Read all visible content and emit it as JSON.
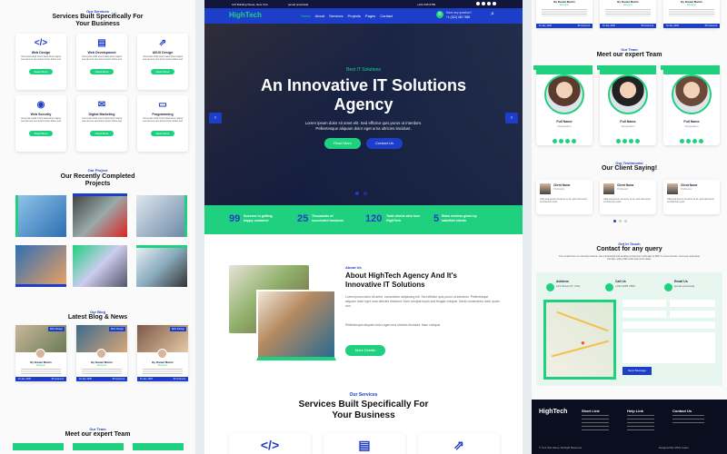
{
  "brand": {
    "name": "HighTech"
  },
  "topbar": {
    "address": "123 Building Street, New York",
    "email": "[email protected]",
    "phone": "+012 345 6789",
    "help": "Have any question?",
    "help_phone": "+1 (202) 445 7865"
  },
  "nav": {
    "items": [
      "Home",
      "About",
      "Services",
      "Projects",
      "Pages",
      "Contact"
    ],
    "active": "Home"
  },
  "hero": {
    "tag": "Best IT Solutions",
    "title_line1": "An Innovative IT Solutions",
    "title_line2": "Agency",
    "text_line1": "Lorem ipsum dolor sit amet elit. Sed efficitur quis purus ut interdum.",
    "text_line2": "Pellentesque aliquam dolor eget urna ultricies tincidunt.",
    "btn_primary": "Read More",
    "btn_secondary": "Contact Us"
  },
  "stats": [
    {
      "value": "99",
      "label": "Success in getting happy customer"
    },
    {
      "value": "25",
      "label": "Thousands of successful business"
    },
    {
      "value": "120",
      "label": "Total clients who love HighTech"
    },
    {
      "value": "5",
      "label": "Stars reviews given by satisfied clients"
    }
  ],
  "about": {
    "tag": "About Us",
    "title_line1": "About HighTech Agency And It's",
    "title_line2": "Innovative IT Solutions",
    "p1": "Lorem ipsum dolor sit amet, consectetur adipiscing elit. Sed efficitur quis purus ut interdum. Pellentesque aliquam dolor eget urna ultricies tincidunt. Nam volutpat turpis sed feugiat volutpat. Morbi consectetur dolor quam non.",
    "p2": "Pellentesque aliquam dolor eget urna ultricies tincidunt. Nam volutpat.",
    "button": "More Details"
  },
  "services": {
    "tag": "Our Services",
    "title_line1": "Services Built Specifically For",
    "title_line2": "Your Business",
    "items": [
      {
        "label": "Web Design",
        "icon": "code-icon"
      },
      {
        "label": "Web Development",
        "icon": "file-code-icon"
      },
      {
        "label": "UI/UX Design",
        "icon": "external-link-icon"
      },
      {
        "label": "Web Security",
        "icon": "user-secret-icon"
      },
      {
        "label": "Digital Marketing",
        "icon": "envelope-open-icon"
      },
      {
        "label": "Programming",
        "icon": "laptop-icon"
      }
    ],
    "item_text": "Amet justo dolor lorem kasd amet magna sea stet eos vero lorem ipsum dolore sed",
    "read_more": "Read More"
  },
  "projects": {
    "tag": "Our Project",
    "title_line1": "Our Recently Completed",
    "title_line2": "Projects"
  },
  "blog": {
    "tag": "Our Blog",
    "title": "Latest Blog & News",
    "category": "Web Design",
    "author": "By Daniel Martin",
    "role": "Designer",
    "date": "01 Jan, 2045",
    "comments": "15 Comment"
  },
  "team": {
    "tag": "Our Team",
    "title": "Meet our expert Team",
    "members": [
      {
        "name": "Full Name",
        "role": "Designation"
      },
      {
        "name": "Full Name",
        "role": "Designation"
      },
      {
        "name": "Full Name",
        "role": "Designation"
      }
    ]
  },
  "testimonial": {
    "tag": "Our Testimonial",
    "title": "Our Client Saying!",
    "client": "Client Name",
    "profession": "Profession",
    "text": "Clita erat ipsum et lorem et sit, sed stet lorem sit clita duo justo."
  },
  "contact": {
    "tag": "Get In Touch",
    "title": "Contact for any query",
    "note": "The contact form is currently inactive. Get a functional and working contact form with Ajax & PHP in a few minutes. Just copy and paste the files, add a little code and you're done.",
    "address_label": "Address",
    "address": "123 Street NY, USA",
    "call_label": "Call Us",
    "call": "+012 3456 7890",
    "email_label": "Email Us",
    "email": "[email protected]",
    "send": "Send Message"
  },
  "footer": {
    "brand": "HighTech",
    "col1": "Short Link",
    "col2": "Help Link",
    "col3": "Contact Us",
    "copyright": "© Your Site Name, All Right Reserved.",
    "designed": "Designed By HTML Codex"
  }
}
